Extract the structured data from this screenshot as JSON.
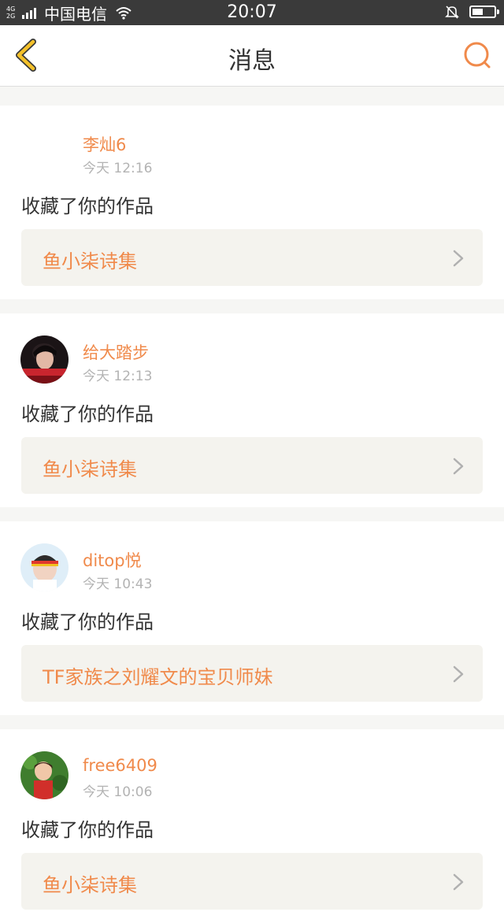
{
  "status_bar": {
    "network_type_top": "4G",
    "network_type_bottom": "2G",
    "carrier": "中国电信",
    "time": "20:07",
    "icons": [
      "signal-icon",
      "wifi-icon",
      "silent-bell-icon",
      "battery-icon"
    ]
  },
  "nav": {
    "title": "消息",
    "back_icon": "chevron-left-icon",
    "search_icon": "search-icon",
    "accent_color": "#f08a4b",
    "back_color": "#f4c12a"
  },
  "messages": [
    {
      "user": "李灿6",
      "time": "今天 12:16",
      "action": "收藏了你的作品",
      "work": "鱼小柒诗集",
      "avatar": "none"
    },
    {
      "user": "给大踏步",
      "time": "今天 12:13",
      "action": "收藏了你的作品",
      "work": "鱼小柒诗集",
      "avatar": "dark-red-portrait"
    },
    {
      "user": "ditop悦",
      "time": "今天 10:43",
      "action": "收藏了你的作品",
      "work": "TF家族之刘耀文的宝贝师妹",
      "avatar": "boy-with-headband"
    },
    {
      "user": "free6409",
      "time": "今天 10:06",
      "action": "收藏了你的作品",
      "work": "鱼小柒诗集",
      "avatar": "child-green-background"
    }
  ]
}
